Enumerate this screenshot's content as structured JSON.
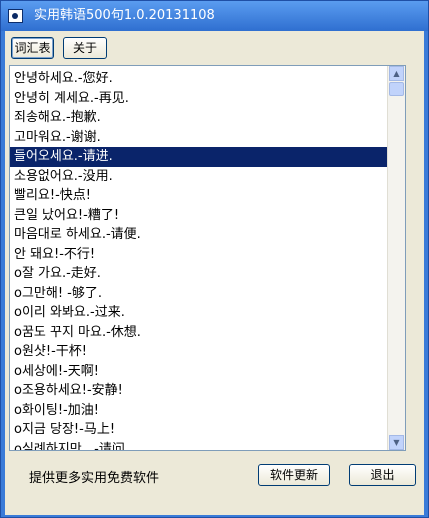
{
  "window": {
    "title": "实用韩语500句1.0.20131108"
  },
  "tabs": {
    "vocab": "词汇表",
    "about": "关于"
  },
  "phrases": {
    "items": [
      "안녕하세요.-您好.",
      "안녕히 계세요.-再见.",
      "죄송해요.-抱歉.",
      "고마워요.-谢谢.",
      "들어오세요.-请进.",
      "소용없어요.-没用.",
      "빨리요!-快点!",
      "큰일 났어요!-糟了!",
      "마음대로 하세요.-请便.",
      "안 돼요!-不行!",
      "o잘 가요.-走好.",
      "o그만해! -够了.",
      "o이리 와봐요.-过来.",
      "o꿈도 꾸지 마요.-休想.",
      "o원샷!-干杯!",
      "o세상에!-天啊!",
      "o조용하세요!-安静!",
      "o화이팅!-加油!",
      "o지금 당장!-马上!",
      "o실례하지만...-请问"
    ],
    "selected_index": 4
  },
  "footer": {
    "promo_text": "提供更多实用免费软件",
    "update_label": "软件更新",
    "exit_label": "退出"
  },
  "colors": {
    "title_bar": "#2f6fd0",
    "selection": "#0a246a",
    "dialog_bg": "#ece9d8"
  }
}
